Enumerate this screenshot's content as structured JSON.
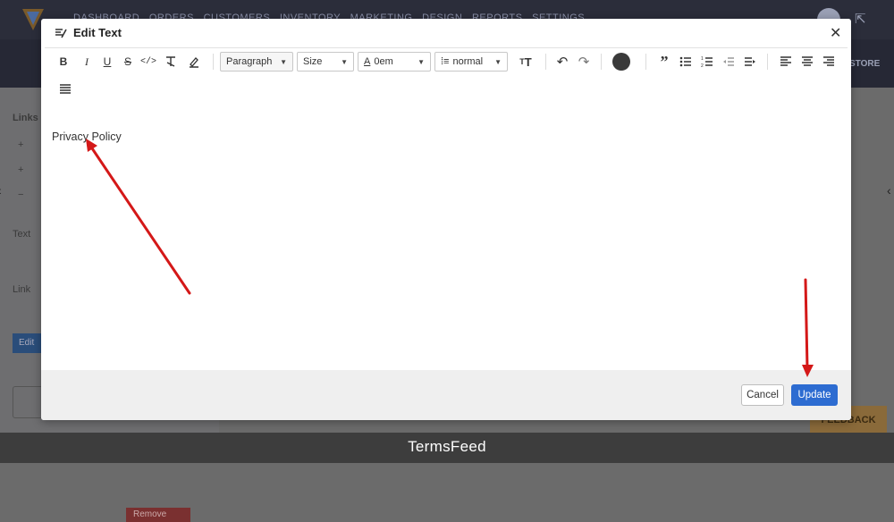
{
  "modal": {
    "title": "Edit Text",
    "toolbar": {
      "paragraph_label": "Paragraph",
      "size_label": "Size",
      "letter_spacing_label": "0em",
      "line_height_label": "normal",
      "text_color": "#3a3a3a"
    },
    "editor_content": "Privacy Policy",
    "cancel_label": "Cancel",
    "update_label": "Update",
    "update_color": "#2d6cd1"
  },
  "caption": "TermsFeed",
  "annotations": {
    "arrow_color": "#d41818"
  }
}
